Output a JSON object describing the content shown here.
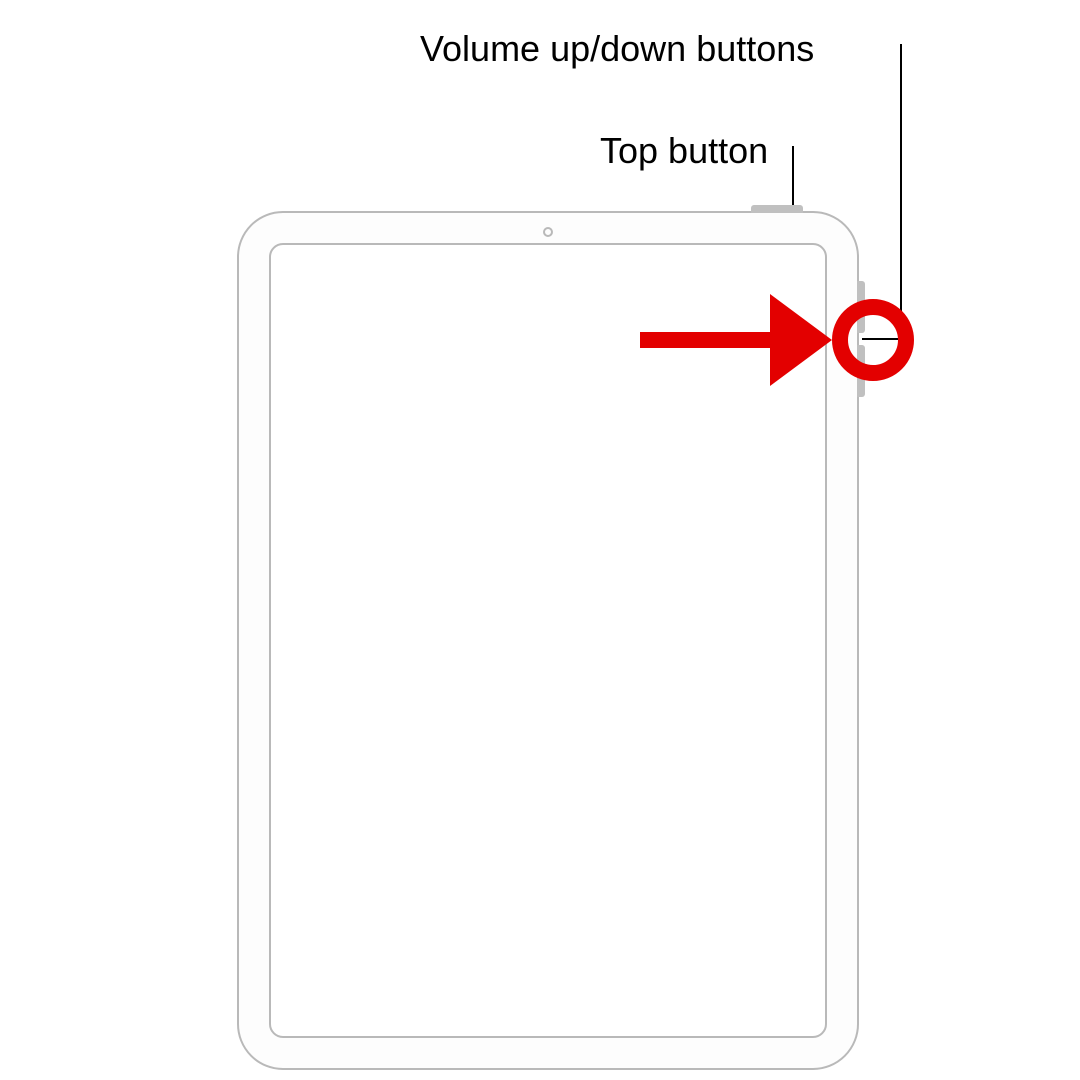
{
  "labels": {
    "volume": "Volume up/down buttons",
    "top_button": "Top button"
  },
  "annotations": {
    "arrow_color": "#e30000",
    "highlight_color": "#e30000",
    "target": "volume-buttons"
  },
  "device": {
    "type": "tablet",
    "outline_color": "#b9b9b9"
  }
}
